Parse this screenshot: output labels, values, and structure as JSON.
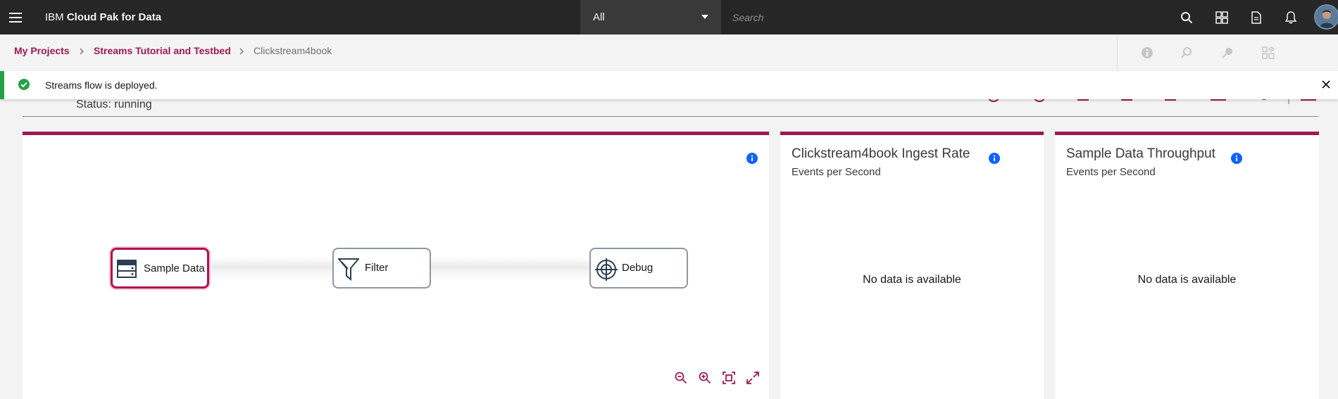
{
  "header": {
    "brand_prefix": "IBM",
    "brand_name": "Cloud Pak for Data",
    "scope_selected": "All",
    "search_placeholder": "Search"
  },
  "breadcrumb": {
    "items": [
      "My Projects",
      "Streams Tutorial and Testbed"
    ],
    "current": "Clickstream4book"
  },
  "notification": {
    "message": "Streams flow is deployed."
  },
  "flow": {
    "status": "Status: running",
    "nodes": [
      "Sample Data",
      "Filter",
      "Debug"
    ]
  },
  "cards": [
    {
      "title": "Clickstream4book Ingest Rate",
      "subtitle": "Events per Second",
      "empty": "No data is available"
    },
    {
      "title": "Sample Data Throughput",
      "subtitle": "Events per Second",
      "empty": "No data is available"
    }
  ],
  "colors": {
    "accent": "#9f1853",
    "success": "#24a148",
    "info": "#0f62fe",
    "topbar": "#262626"
  },
  "icons": [
    "menu-icon",
    "chevron-down-icon",
    "search-icon",
    "apps-icon",
    "document-icon",
    "notification-icon",
    "info-icon",
    "zoom-out-icon",
    "zoom-in-icon",
    "fit-icon",
    "expand-icon"
  ]
}
